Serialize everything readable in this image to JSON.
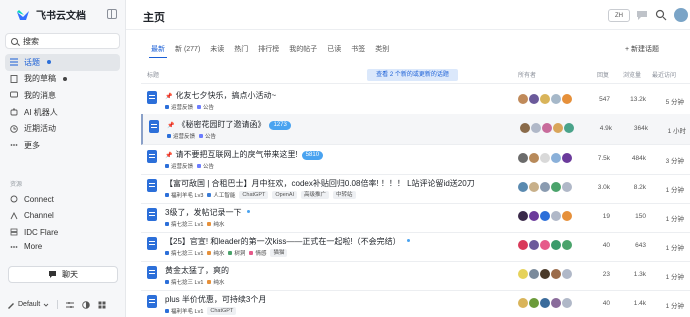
{
  "sidebar": {
    "brand": "飞书云文档",
    "search_label": "搜索",
    "items": [
      {
        "label": "话题",
        "active": true,
        "dot": "#2c6fd9"
      },
      {
        "label": "我的草稿",
        "dot": "#444"
      },
      {
        "label": "我的消息"
      },
      {
        "label": "AI 机器人"
      },
      {
        "label": "近期活动"
      },
      {
        "label": "更多"
      }
    ],
    "section_label": "资源",
    "resources": [
      {
        "label": "Connect"
      },
      {
        "label": "Channel"
      },
      {
        "label": "IDC Flare"
      },
      {
        "label": "More"
      }
    ],
    "chat_button": "聊天",
    "theme_label": "Default"
  },
  "header": {
    "title": "主页",
    "lang": "ZH"
  },
  "tabs": [
    "最新",
    "新 (277)",
    "未读",
    "热门",
    "排行榜",
    "我的帖子",
    "已读",
    "书签",
    "类别"
  ],
  "new_topic": "+ 新建话题",
  "table": {
    "headers": {
      "topic": "标题",
      "posters": "所有者",
      "replies": "回复",
      "views": "浏览量",
      "activity": "最近访问"
    },
    "notice": "查看 2 个新的或更新的话题",
    "rows": [
      {
        "pin": true,
        "title": "化友七夕快乐，搞点小活动~",
        "meta": [
          "运营反馈"
        ],
        "tags": [
          {
            "name": "公告",
            "color": "#6b7cff"
          }
        ],
        "avatars": [
          "#c08a5a",
          "#6b5a9b",
          "#d9b45a",
          "#a6b8c9",
          "#e6903a"
        ],
        "replies": "547",
        "views": "13.2k",
        "activity": "5 分钟"
      },
      {
        "pin": true,
        "title": "《秘密花园盯了邀请函》",
        "badge": "1273",
        "meta": [
          "运营反馈"
        ],
        "tags": [
          {
            "name": "公告",
            "color": "#6b7cff"
          }
        ],
        "avatars": [
          "#8a6b4a",
          "#b0b8c8",
          "#c86b9b",
          "#d9a55a",
          "#4aa38a"
        ],
        "replies": "4.9k",
        "views": "364k",
        "activity": "1 小时",
        "highlight": true
      },
      {
        "pin": true,
        "title": "请不要把互联网上的戾气带来这里!",
        "badge": "5810",
        "meta": [
          "运营反馈"
        ],
        "tags": [
          {
            "name": "公告",
            "color": "#6b7cff"
          }
        ],
        "avatars": [
          "#6b6b6b",
          "#b88a5a",
          "#d9d9d9",
          "#8ab0d9",
          "#6b3a9b"
        ],
        "replies": "7.5k",
        "views": "484k",
        "activity": "3 分钟"
      },
      {
        "title": "【富可敌国 | 合租巴士】月中狂欢，codex补贴回归0.08倍率! ！！！ L站评论留id送20刀",
        "meta": [
          "福利羊毛 Lv3"
        ],
        "tags": [
          {
            "name": "人工智能",
            "color": "#3a7bd5"
          },
          {
            "name": "ChatGPT"
          },
          {
            "name": "OpenAI"
          },
          {
            "name": "高级推广"
          },
          {
            "name": "中转站"
          }
        ],
        "avatars": [
          "#5a8ab0",
          "#c8b08a",
          "#8a9bb0",
          "#4aa36b",
          "#b0b8c8"
        ],
        "replies": "3.0k",
        "views": "8.2k",
        "activity": "1 分钟"
      },
      {
        "title": "3级了，发帖记录一下",
        "dot": true,
        "meta": [
          "搞七捻三 Lv1"
        ],
        "tags": [
          {
            "name": "纯水",
            "color": "#e6903a"
          }
        ],
        "avatars": [
          "#3a2a4a",
          "#6b3a9b",
          "#2c6fd9",
          "#b0b8c8",
          "#e6903a"
        ],
        "replies": "19",
        "views": "150",
        "activity": "1 分钟"
      },
      {
        "title": "【25】官宣! 和leader的第一次kiss——正式在一起啦!（不会完结）",
        "dot": true,
        "meta": [
          "搞七捻三 Lv1"
        ],
        "tags": [
          {
            "name": "纯水",
            "color": "#e6903a"
          },
          {
            "name": "树洞",
            "color": "#4aa36b"
          },
          {
            "name": "情感",
            "color": "#e65a8a"
          },
          {
            "name": "猫猫"
          }
        ],
        "avatars": [
          "#d93a5a",
          "#6b5a9b",
          "#e65a8a",
          "#3a9b6b",
          "#4aa36b"
        ],
        "replies": "40",
        "views": "643",
        "activity": "1 分钟"
      },
      {
        "title": "黄金太猛了，爽的",
        "meta": [
          "搞七捻三 Lv1"
        ],
        "tags": [
          {
            "name": "纯水",
            "color": "#e6903a"
          }
        ],
        "avatars": [
          "#e6d25a",
          "#7a8a9b",
          "#4a3a2a",
          "#9b6b4a",
          "#b0b8c8"
        ],
        "replies": "23",
        "views": "1.3k",
        "activity": "1 分钟"
      },
      {
        "title": "plus 半价优惠，可持续3个月",
        "meta": [
          "福利羊毛 Lv1"
        ],
        "tags": [
          {
            "name": "ChatGPT"
          }
        ],
        "avatars": [
          "#d9b45a",
          "#6b9b3a",
          "#3a6b9b",
          "#8a6b9b",
          "#b0b8c8"
        ],
        "replies": "40",
        "views": "1.4k",
        "activity": "1 分钟"
      }
    ]
  }
}
